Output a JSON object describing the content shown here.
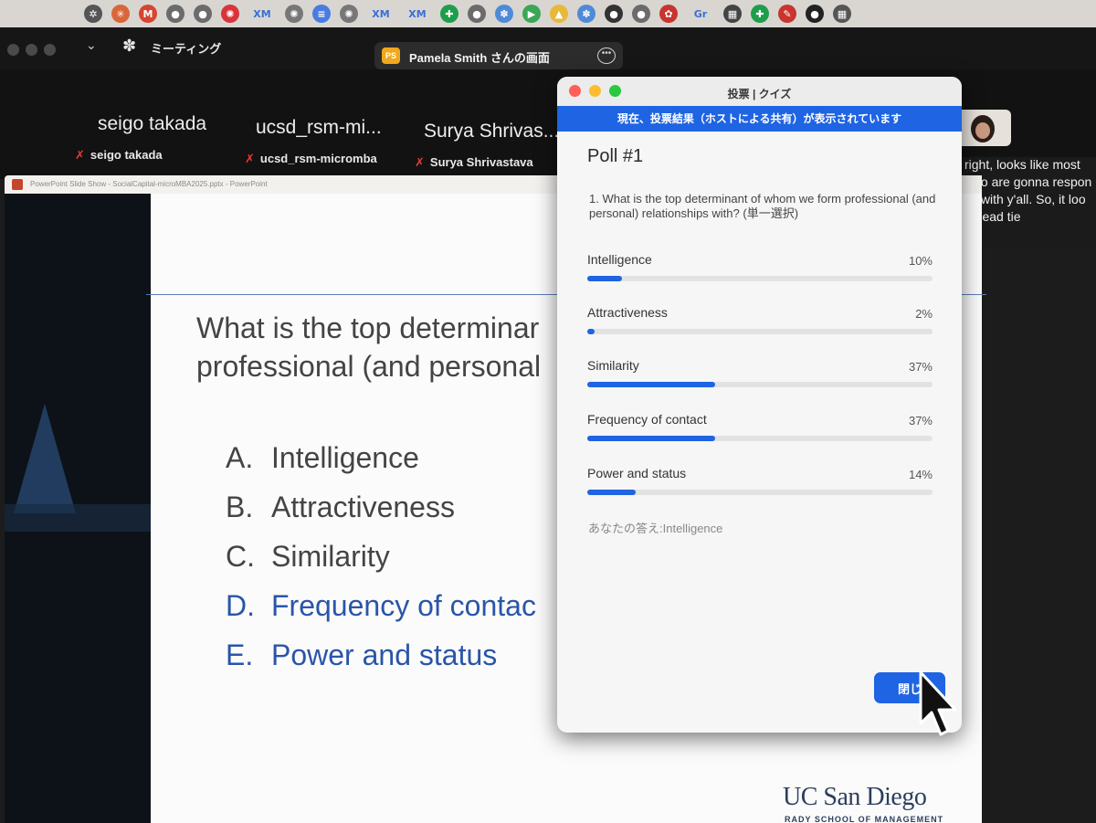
{
  "bookmarks": [
    {
      "icon": "openai-icon",
      "glyph": "✲",
      "color": "#555555"
    },
    {
      "icon": "claude-icon",
      "glyph": "✳",
      "color": "#d9663a"
    },
    {
      "icon": "gmail-icon",
      "glyph": "M",
      "color": "#d64532"
    },
    {
      "icon": "globe-icon",
      "glyph": "●",
      "color": "#6b6b6b"
    },
    {
      "icon": "globe-icon",
      "glyph": "●",
      "color": "#6b6b6b"
    },
    {
      "icon": "ball-icon",
      "glyph": "✺",
      "color": "#d8343a"
    },
    {
      "text": "XM"
    },
    {
      "icon": "dot-icon",
      "glyph": "✺",
      "color": "#777777"
    },
    {
      "icon": "docs-icon",
      "glyph": "≡",
      "color": "#4a7be0"
    },
    {
      "icon": "dot-icon",
      "glyph": "✺",
      "color": "#777777"
    },
    {
      "text": "XM"
    },
    {
      "text": "XM"
    },
    {
      "icon": "sheets-icon",
      "glyph": "✚",
      "color": "#1e9e4b"
    },
    {
      "icon": "globe-icon",
      "glyph": "●",
      "color": "#6b6b6b"
    },
    {
      "icon": "gear-icon",
      "glyph": "✽",
      "color": "#4e8ad8"
    },
    {
      "icon": "play-icon",
      "glyph": "▶",
      "color": "#3aa757"
    },
    {
      "icon": "drive-icon",
      "glyph": "▲",
      "color": "#e7b93a"
    },
    {
      "icon": "gear-icon",
      "glyph": "✽",
      "color": "#4e8ad8"
    },
    {
      "icon": "dark-icon",
      "glyph": "●",
      "color": "#333333"
    },
    {
      "icon": "globe-icon",
      "glyph": "●",
      "color": "#6b6b6b"
    },
    {
      "icon": "red-icon",
      "glyph": "✿",
      "color": "#c8342e"
    },
    {
      "text": "Gr"
    },
    {
      "icon": "grid-icon",
      "glyph": "▦",
      "color": "#444444"
    },
    {
      "icon": "sheets-icon",
      "glyph": "✚",
      "color": "#1e9e4b"
    },
    {
      "icon": "tool-icon",
      "glyph": "✎",
      "color": "#c8342e"
    },
    {
      "icon": "github-icon",
      "glyph": "●",
      "color": "#222222"
    },
    {
      "icon": "school-icon",
      "glyph": "▦",
      "color": "#555555"
    }
  ],
  "zoom": {
    "meeting_label": "ミーティング",
    "share_avatar": "PS",
    "share_title": "Pamela Smith さんの画面"
  },
  "participants": [
    {
      "name": "seigo takada",
      "sub": "seigo takada"
    },
    {
      "name": "ucsd_rsm-mi...",
      "sub": "ucsd_rsm-micromba"
    },
    {
      "name": "Surya Shrivas...",
      "sub": "Surya Shrivastava"
    }
  ],
  "chat_lines": [
    "right, looks like most",
    "who are gonna respon",
    "lts with y'all. So, it loo",
    "a dead tie"
  ],
  "ppt": {
    "title": "PowerPoint Slide Show  -  SocialCapital-microMBA2025.pptx  -  PowerPoint",
    "question_line1": "What is the top determinar",
    "question_line2": "professional (and personal",
    "options": [
      {
        "letter": "A.",
        "text": "Intelligence"
      },
      {
        "letter": "B.",
        "text": "Attractiveness"
      },
      {
        "letter": "C.",
        "text": "Similarity"
      },
      {
        "letter": "D.",
        "text": "Frequency of contac"
      },
      {
        "letter": "E.",
        "text": "Power and status"
      }
    ],
    "logo": "UC San Diego",
    "logo_sub": "RADY SCHOOL OF MANAGEMENT"
  },
  "poll": {
    "window_title": "投票 | クイズ",
    "banner": "現在、投票結果（ホストによる共有）が表示されています",
    "heading": "Poll #1",
    "question": "1. What is the top determinant of whom we form professional (and personal) relationships with? (単一選択)",
    "options": [
      {
        "label": "Intelligence",
        "percent_label": "10%",
        "percent": 10
      },
      {
        "label": "Attractiveness",
        "percent_label": "2%",
        "percent": 2
      },
      {
        "label": "Similarity",
        "percent_label": "37%",
        "percent": 37
      },
      {
        "label": "Frequency of contact",
        "percent_label": "37%",
        "percent": 37
      },
      {
        "label": "Power and status",
        "percent_label": "14%",
        "percent": 14
      }
    ],
    "your_answer": "あなたの答え:Intelligence",
    "close_label": "閉じ",
    "accent": "#1e64e3"
  }
}
